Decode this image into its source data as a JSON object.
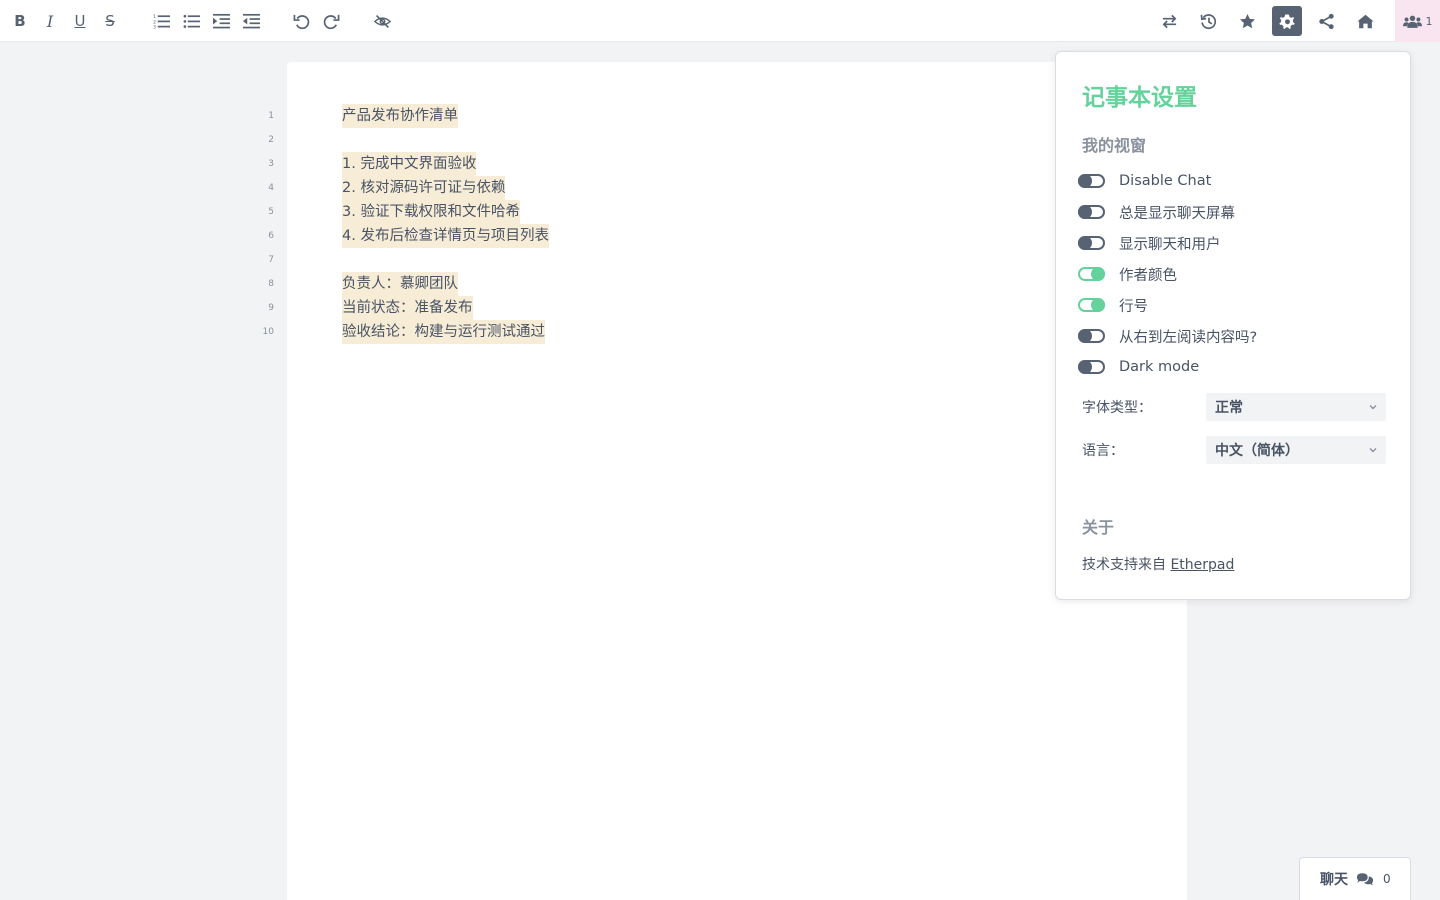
{
  "toolbar": {
    "bold_label": "B",
    "italic_label": "I",
    "underline_label": "U",
    "strike_label": "S",
    "icons": [
      "bold-icon",
      "italic-icon",
      "underline-icon",
      "strikethrough-icon",
      "ordered-list-icon",
      "unordered-list-icon",
      "indent-icon",
      "outdent-icon",
      "undo-icon",
      "redo-icon",
      "hide-authorship-icon",
      "import-export-icon",
      "timeslider-icon",
      "star-icon",
      "settings-icon",
      "share-icon",
      "home-icon",
      "users-icon"
    ],
    "active_button": "settings",
    "user_count": "1"
  },
  "editor": {
    "line_numbers": [
      "1",
      "2",
      "3",
      "4",
      "5",
      "6",
      "7",
      "8",
      "9",
      "10"
    ],
    "lines": [
      "产品发布协作清单",
      "",
      "1. 完成中文界面验收",
      "2. 核对源码许可证与依赖",
      "3. 验证下载权限和文件哈希",
      "4. 发布后检查详情页与项目列表",
      "",
      "负责人：慕卿团队",
      "当前状态：准备发布",
      "验收结论：构建与运行测试通过"
    ],
    "author_color": "#f7ecd6"
  },
  "settings": {
    "title": "记事本设置",
    "my_view": "我的视窗",
    "options": [
      {
        "label": "Disable Chat",
        "on": false
      },
      {
        "label": "总是显示聊天屏幕",
        "on": false
      },
      {
        "label": "显示聊天和用户",
        "on": false
      },
      {
        "label": "作者颜色",
        "on": true
      },
      {
        "label": "行号",
        "on": true
      },
      {
        "label": "从右到左阅读内容吗?",
        "on": false
      },
      {
        "label": "Dark mode",
        "on": false
      }
    ],
    "font_type_label": "字体类型：",
    "font_type_value": "正常",
    "language_label": "语言：",
    "language_value": "中文（简体）",
    "about_heading": "关于",
    "powered_by": "技术支持来自",
    "powered_link": "Etherpad",
    "accent_color": "#64d29b"
  },
  "chat": {
    "label": "聊天",
    "count": "0"
  }
}
